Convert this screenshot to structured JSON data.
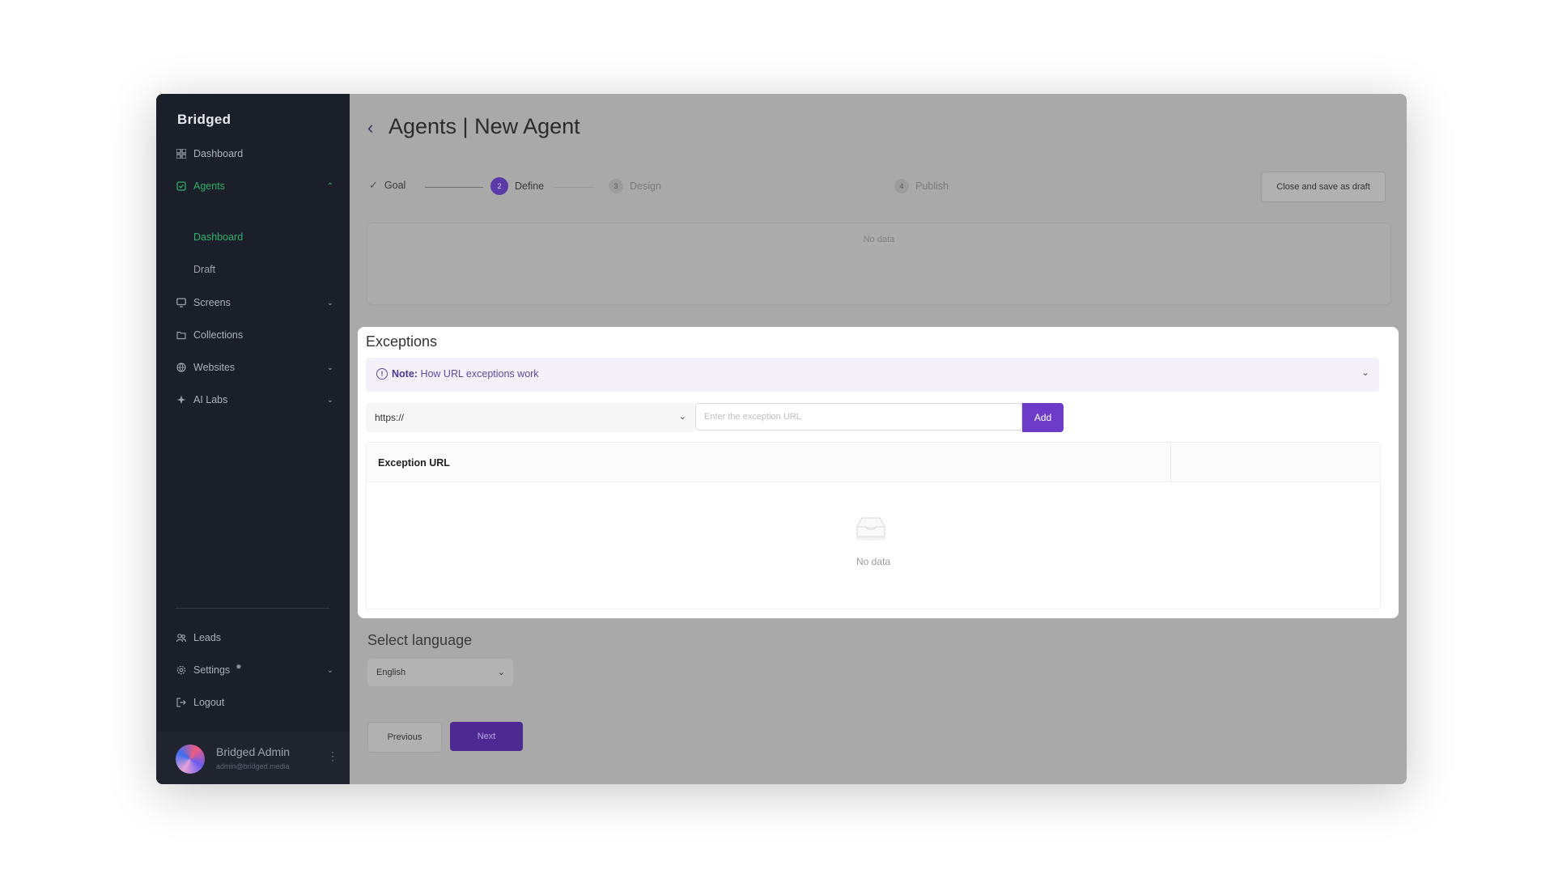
{
  "brand": {
    "logo": "Bridged"
  },
  "sidebar": {
    "items": [
      {
        "label": "Dashboard",
        "icon": "grid-icon"
      },
      {
        "label": "Agents",
        "icon": "agent-icon"
      },
      {
        "label": "Screens",
        "icon": "monitor-icon"
      },
      {
        "label": "Collections",
        "icon": "folder-icon"
      },
      {
        "label": "Websites",
        "icon": "globe-icon"
      },
      {
        "label": "AI Labs",
        "icon": "sparkle-icon"
      }
    ],
    "agents_sub": [
      {
        "label": "Dashboard"
      },
      {
        "label": "Draft"
      }
    ],
    "bottom_items": [
      {
        "label": "Leads",
        "icon": "users-icon"
      },
      {
        "label": "Settings",
        "icon": "gear-icon"
      },
      {
        "label": "Logout",
        "icon": "logout-icon"
      }
    ],
    "user": {
      "name": "Bridged Admin",
      "email": "admin@bridged.media"
    }
  },
  "header": {
    "title": "Agents | New Agent"
  },
  "steps": [
    {
      "label": "Goal",
      "marker": "✓"
    },
    {
      "label": "Define",
      "marker": "2"
    },
    {
      "label": "Design",
      "marker": "3"
    },
    {
      "label": "Publish",
      "marker": "4"
    }
  ],
  "draft_button": "Close and save as draft",
  "top_card": {
    "empty_text": "No data"
  },
  "exceptions": {
    "title": "Exceptions",
    "note_label": "Note:",
    "note_text": "How URL exceptions work",
    "protocol_value": "https://",
    "url_placeholder": "Enter the exception URL",
    "add_label": "Add",
    "column_header": "Exception URL",
    "empty_text": "No data"
  },
  "language": {
    "title": "Select language",
    "value": "English"
  },
  "nav_buttons": {
    "previous": "Previous",
    "next": "Next"
  },
  "colors": {
    "accent": "#6c3cc8",
    "active_green": "#2fb26a",
    "sidebar_bg": "#1b1f2a"
  }
}
